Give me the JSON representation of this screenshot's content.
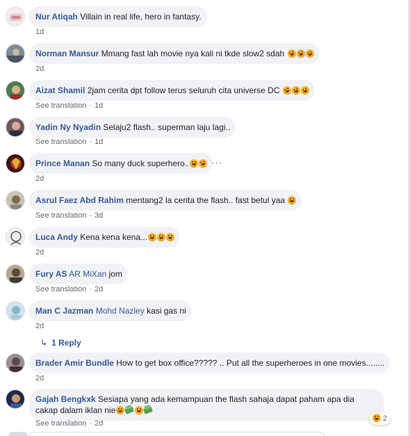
{
  "comments": [
    {
      "author": "Nur Atiqah",
      "text": "Villain in real life, hero in fantasy.",
      "time": "1d"
    },
    {
      "author": "Norman Mansur",
      "text": "Mmang fast lah movie nya kali ni tkde slow2 sdah",
      "time": "2d"
    },
    {
      "author": "Aizat Shamil",
      "text": "2jam cerita dpt follow terus seluruh cita universe DC",
      "see_translation": "See translation",
      "time": "1d"
    },
    {
      "author": "Yadin Ny Nyadin",
      "text": "Selaju2 flash.. superman laju lagi..",
      "see_translation": "See translation",
      "time": "1d"
    },
    {
      "author": "Prince Manan",
      "text": "So many duck superhero..",
      "time": "2d"
    },
    {
      "author": "Asrul Faez Abd Rahim",
      "text": "mentang2 la cerita the flash.. fast betul yaa",
      "see_translation": "See translation",
      "time": "3d"
    },
    {
      "author": "Luca Andy",
      "text": "Kena kena kena...",
      "time": "2d"
    },
    {
      "author": "Fury AS",
      "author_extra": "AR MiXan",
      "text": "jom",
      "see_translation": "See translation",
      "time": "2d"
    },
    {
      "author": "Man C Jazman",
      "author_extra": "Mohd Nazley",
      "text": "kasi gas ni",
      "time": "2d",
      "replies_label": "1 Reply"
    },
    {
      "author": "Brader Amir Bundle",
      "text": "How to get box office????? .. Put all the superheroes in one movies........",
      "time": "2d"
    },
    {
      "author": "Gajah Bengkxk",
      "text": "Sesiapa yang ada kemampuan the flash sahaja dapat paham apa dia cakap dalam iklan nie",
      "see_translation": "See translation",
      "time": "2d",
      "reaction_count": "2"
    }
  ],
  "icons": {
    "more": "more-options-icon",
    "reply_arrow": "reply-arrow-icon",
    "reaction": "haha-reaction-icon"
  },
  "colors": {
    "bubble": "#f0f2f5",
    "link": "#385898",
    "meta": "#65676b",
    "emoji": "#f7b125"
  }
}
